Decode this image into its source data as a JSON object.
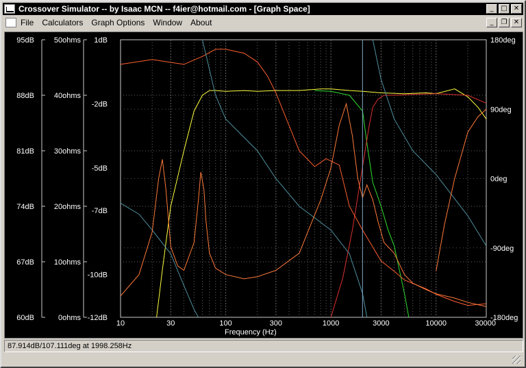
{
  "window": {
    "title": "Crossover Simulator -- by Isaac MCN -- f4ier@hotmail.com - [Graph Space]",
    "minimize_glyph": "_",
    "maximize_glyph": "□",
    "close_glyph": "✕",
    "restore_glyph": "❐"
  },
  "menu": [
    "File",
    "Calculators",
    "Graph Options",
    "Window",
    "About"
  ],
  "status": "87.914dB/107.111deg at 1998.258Hz",
  "axes": {
    "db_ticks": [
      "95dB",
      "88dB",
      "81dB",
      "74dB",
      "67dB",
      "60dB"
    ],
    "ohm_ticks": [
      "50ohms",
      "40ohms",
      "30ohms",
      "20ohms",
      "10ohms",
      "0ohms"
    ],
    "rel_db_ticks": [
      "1dB",
      "-2dB",
      "-5dB",
      "-7dB",
      "-10dB",
      "-12dB"
    ],
    "deg_ticks": [
      "180deg",
      "90deg",
      "0deg",
      "-90deg",
      "-180deg"
    ],
    "freq_ticks": [
      "10",
      "30",
      "100",
      "300",
      "1000",
      "3000",
      "10000",
      "30000"
    ],
    "xlabel": "Frequency (Hz)"
  },
  "chart_data": {
    "type": "line",
    "x_scale": "log",
    "xlim": [
      10,
      30000
    ],
    "ylim_db": [
      60,
      95
    ],
    "xlabel": "Frequency (Hz)",
    "cursor_hz": 1998.258,
    "series": [
      {
        "color": "#ffff40",
        "x": [
          22,
          25,
          30,
          40,
          50,
          60,
          70,
          80,
          100,
          150,
          200,
          300,
          500,
          800,
          1000,
          1500,
          2000,
          3000,
          5000,
          8000,
          10000,
          15000,
          20000,
          25000,
          30000
        ],
        "y": [
          60,
          66,
          74,
          81,
          86,
          88,
          88.6,
          88.6,
          88.5,
          88.6,
          88.5,
          88.6,
          88.6,
          88.8,
          88.8,
          88.6,
          88.5,
          88.3,
          88.2,
          88.3,
          88.2,
          88.8,
          87.8,
          86.5,
          85
        ]
      },
      {
        "color": "#30e030",
        "x": [
          700,
          1000,
          1500,
          2000,
          2200,
          2500,
          3000,
          3500,
          4000,
          5000,
          5500
        ],
        "y": [
          88.6,
          88.5,
          88,
          86,
          82,
          77,
          74,
          71,
          69,
          63,
          60
        ]
      },
      {
        "color": "#e03030",
        "x": [
          1000,
          1300,
          1600,
          2000,
          2300,
          2500,
          2800,
          3200,
          4000,
          6000,
          10000,
          20000,
          30000
        ],
        "y": [
          60,
          65,
          71,
          79,
          84,
          86.5,
          87.5,
          88,
          88,
          88.1,
          88.2,
          88,
          87
        ]
      },
      {
        "color": "#ff6030",
        "x": [
          10,
          20,
          40,
          60,
          80,
          100,
          150,
          200,
          250,
          300,
          500,
          700,
          900,
          1200,
          1500,
          2000,
          3000,
          4000,
          5000,
          8000,
          10000,
          15000,
          20000,
          30000
        ],
        "y": [
          91.9,
          92.5,
          91.9,
          92.9,
          93.8,
          93.8,
          93.3,
          92.2,
          90.4,
          88.3,
          81,
          79,
          80,
          79.2,
          74,
          71,
          67.1,
          65.8,
          64.7,
          63.6,
          62.9,
          62,
          61.5,
          61.7
        ]
      },
      {
        "color": "#4f8f9f",
        "x": [
          10,
          15,
          20,
          30,
          40,
          50,
          55,
          60,
          80,
          100,
          200,
          300,
          500,
          1000,
          1500,
          2000,
          2200,
          2500,
          3000,
          4000,
          6000,
          10000,
          20000,
          30000
        ],
        "y": [
          74.4,
          73,
          71,
          68,
          64,
          61,
          60,
          95,
          88,
          85,
          81,
          77.5,
          74,
          71,
          68,
          63,
          60,
          95,
          90,
          85,
          81,
          78,
          72.8,
          69
        ]
      },
      {
        "color": "#ff7a3a",
        "x": [
          10,
          15,
          20,
          23,
          25,
          27,
          30,
          35,
          40,
          50,
          55,
          58,
          62,
          65,
          70,
          80,
          100,
          150,
          200,
          300,
          500,
          800,
          1000,
          1200,
          1400,
          1600,
          1800,
          2000,
          2200,
          2500,
          2800,
          3200,
          4000,
          5000,
          6000,
          8000,
          10000,
          15000,
          20000,
          30000
        ],
        "y": [
          -11.0,
          -10.0,
          -8.0,
          -5.5,
          -4.6,
          -6.0,
          -8.7,
          -9.6,
          -9.8,
          -8.5,
          -6.5,
          -5.2,
          -6.0,
          -7.5,
          -9.0,
          -9.7,
          -10.0,
          -10.2,
          -10.1,
          -9.8,
          -9.0,
          -6.5,
          -5.0,
          -3.0,
          -2.0,
          -3.5,
          -5.5,
          -6.4,
          -5.8,
          -6.5,
          -7.5,
          -8.5,
          -9.0,
          -10.0,
          -10.4,
          -10.7,
          -10.9,
          -11.1,
          -11.3,
          -11.5
        ]
      },
      {
        "color": "#ff7a3a",
        "x": [
          10000,
          12000,
          15000,
          20000,
          25000,
          30000
        ],
        "y": [
          -120,
          -60,
          0,
          60,
          80,
          90
        ]
      }
    ]
  }
}
